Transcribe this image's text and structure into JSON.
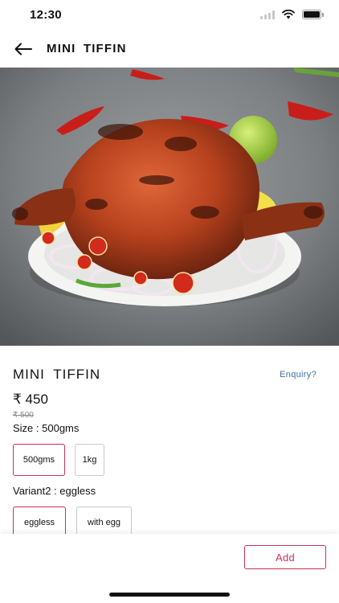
{
  "status": {
    "time": "12:30"
  },
  "header": {
    "title": "MINI  TIFFIN",
    "back_icon": "arrow-left-icon"
  },
  "hero": {
    "description_icon": "food-photo"
  },
  "product": {
    "title": "MINI  TIFFIN",
    "enquiry_label": "Enquiry?",
    "price": "₹ 450",
    "old_price": "₹ 500",
    "size_label": "Size  :  500gms",
    "size_options": [
      "500gms",
      "1kg"
    ],
    "variant_label": "Variant2  :  eggless",
    "variant_options": [
      "eggless",
      "with egg"
    ]
  },
  "bottom": {
    "add_label": "Add"
  },
  "colors": {
    "accent": "#c8325a",
    "link": "#3a6fb0"
  }
}
